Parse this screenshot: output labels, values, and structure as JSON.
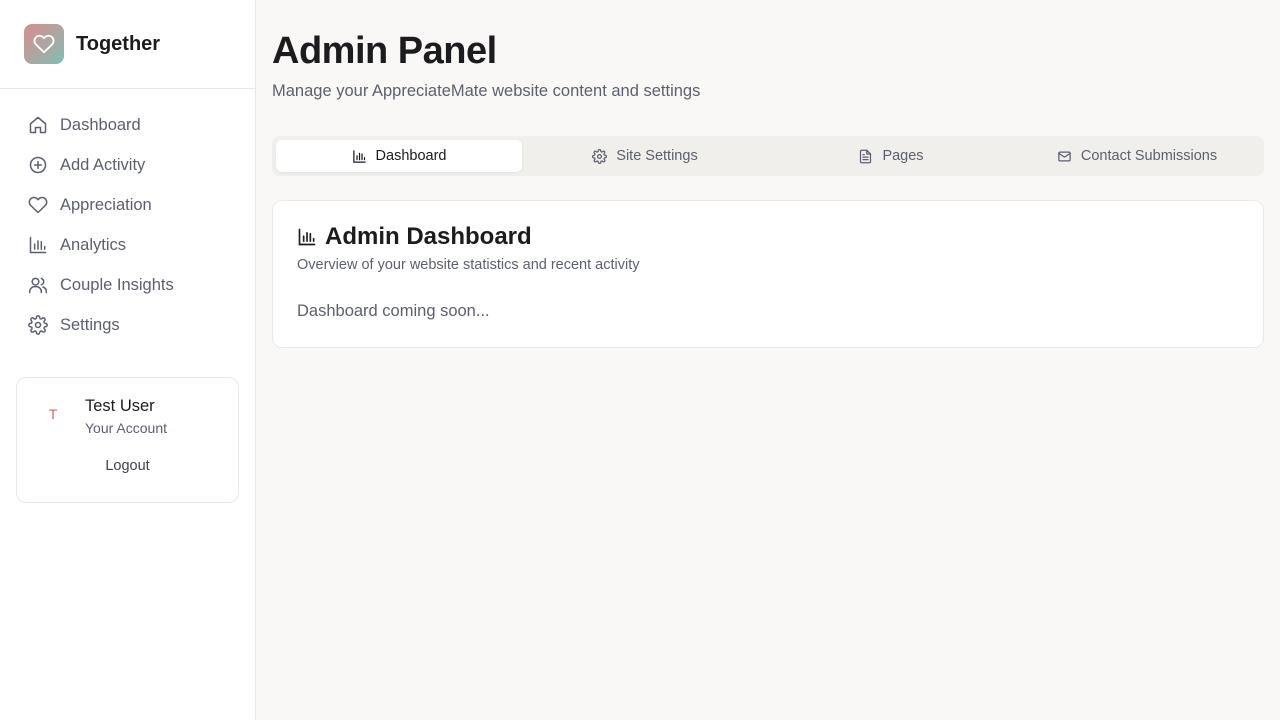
{
  "brand": {
    "name": "Together",
    "logo_icon": "heart-icon",
    "accent_from": "#d98d8d",
    "accent_to": "#7fbfb3"
  },
  "sidebar": {
    "items": [
      {
        "label": "Dashboard",
        "icon": "home-icon"
      },
      {
        "label": "Add Activity",
        "icon": "plus-circle-icon"
      },
      {
        "label": "Appreciation",
        "icon": "heart-icon"
      },
      {
        "label": "Analytics",
        "icon": "bar-chart-icon"
      },
      {
        "label": "Couple Insights",
        "icon": "users-icon"
      },
      {
        "label": "Settings",
        "icon": "gear-icon"
      }
    ]
  },
  "user": {
    "avatar_initial": "T",
    "name": "Test User",
    "subtitle": "Your Account",
    "logout_label": "Logout"
  },
  "header": {
    "title": "Admin Panel",
    "subtitle": "Manage your AppreciateMate website content and settings"
  },
  "tabs": [
    {
      "label": "Dashboard",
      "icon": "bar-chart-icon",
      "active": true
    },
    {
      "label": "Site Settings",
      "icon": "gear-icon",
      "active": false
    },
    {
      "label": "Pages",
      "icon": "file-text-icon",
      "active": false
    },
    {
      "label": "Contact Submissions",
      "icon": "mail-icon",
      "active": false
    }
  ],
  "card": {
    "title": "Admin Dashboard",
    "icon": "bar-chart-icon",
    "subtitle": "Overview of your website statistics and recent activity",
    "body": "Dashboard coming soon..."
  }
}
